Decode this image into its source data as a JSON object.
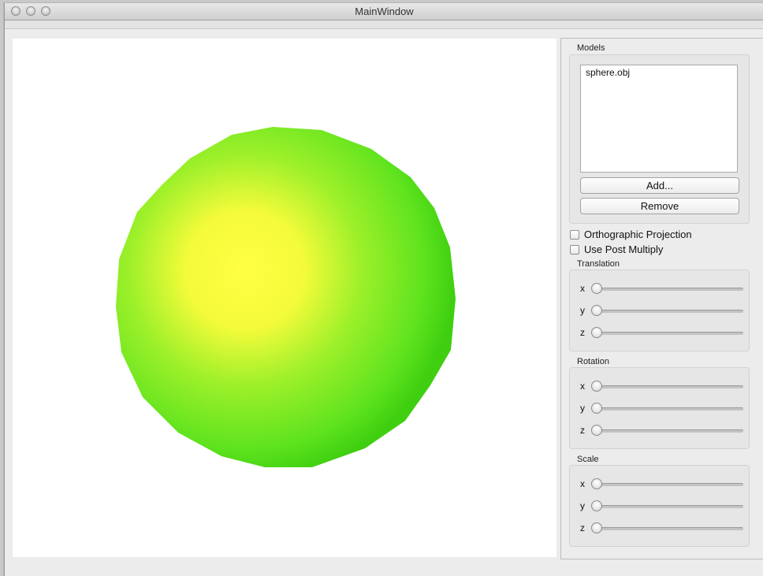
{
  "window": {
    "title": "MainWindow"
  },
  "viewport": {
    "model_color_center": "#ffff44",
    "model_color_edge": "#3fcf10",
    "background": "#ffffff"
  },
  "models": {
    "title": "Models",
    "items": [
      "sphere.obj"
    ],
    "add_label": "Add...",
    "remove_label": "Remove"
  },
  "options": {
    "orthographic_label": "Orthographic Projection",
    "orthographic_checked": false,
    "post_multiply_label": "Use Post Multiply",
    "post_multiply_checked": false
  },
  "translation": {
    "title": "Translation",
    "x": "x",
    "y": "y",
    "z": "z"
  },
  "rotation": {
    "title": "Rotation",
    "x": "x",
    "y": "y",
    "z": "z"
  },
  "scale": {
    "title": "Scale",
    "x": "x",
    "y": "y",
    "z": "z"
  }
}
